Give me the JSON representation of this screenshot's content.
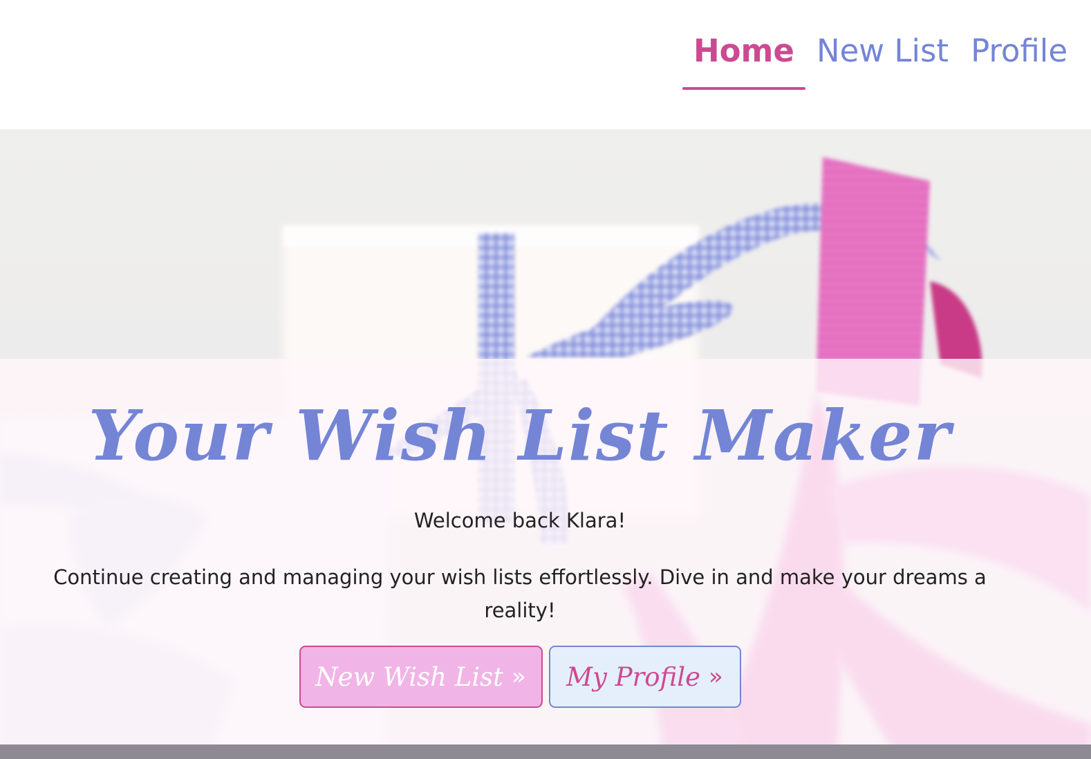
{
  "nav": {
    "items": [
      {
        "label": "Home",
        "active": true
      },
      {
        "label": "New List",
        "active": false
      },
      {
        "label": "Profile",
        "active": false
      }
    ]
  },
  "hero": {
    "title": "Your Wish List Maker",
    "welcome": "Welcome back Klara!",
    "tagline": "Continue creating and managing your wish lists effortlessly. Dive in and make your dreams a reality!",
    "buttons": {
      "new_wish_list": "New Wish List",
      "my_profile": "My Profile",
      "chevron_icon": "double-chevron-right-icon"
    },
    "background_image": "gift boxes with blue gingham and pink satin ribbons"
  },
  "colors": {
    "accent_pink": "#cc4a92",
    "accent_blue": "#7485d6",
    "button_pink_fill": "#f1b4e6",
    "button_blue_fill": "#e5effb",
    "text_dark": "#222222"
  }
}
